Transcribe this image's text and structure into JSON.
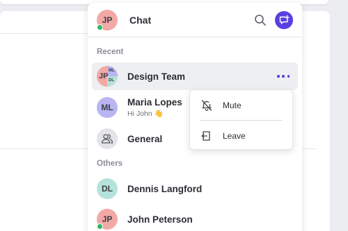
{
  "header": {
    "avatar_initials": "JP",
    "title": "Chat"
  },
  "sections": {
    "recent": "Recent",
    "others": "Others"
  },
  "recent": [
    {
      "name": "Design Team",
      "initials": {
        "main": "JP",
        "top": "ML",
        "bottom": "DL"
      }
    },
    {
      "name": "Maria Lopes",
      "initials": "ML",
      "preview": "Hi John 👋"
    },
    {
      "name": "General"
    }
  ],
  "others": [
    {
      "name": "Dennis Langford",
      "initials": "DL"
    },
    {
      "name": "John Peterson",
      "initials": "JP"
    }
  ],
  "menu": {
    "mute": "Mute",
    "leave": "Leave"
  },
  "colors": {
    "accent": "#5a3fe0",
    "online": "#35b66a",
    "avatar_red": "#f2a9a6",
    "avatar_purple": "#b9b4f2",
    "avatar_teal": "#b5e3dc",
    "avatar_gray": "#e3e4e8"
  }
}
